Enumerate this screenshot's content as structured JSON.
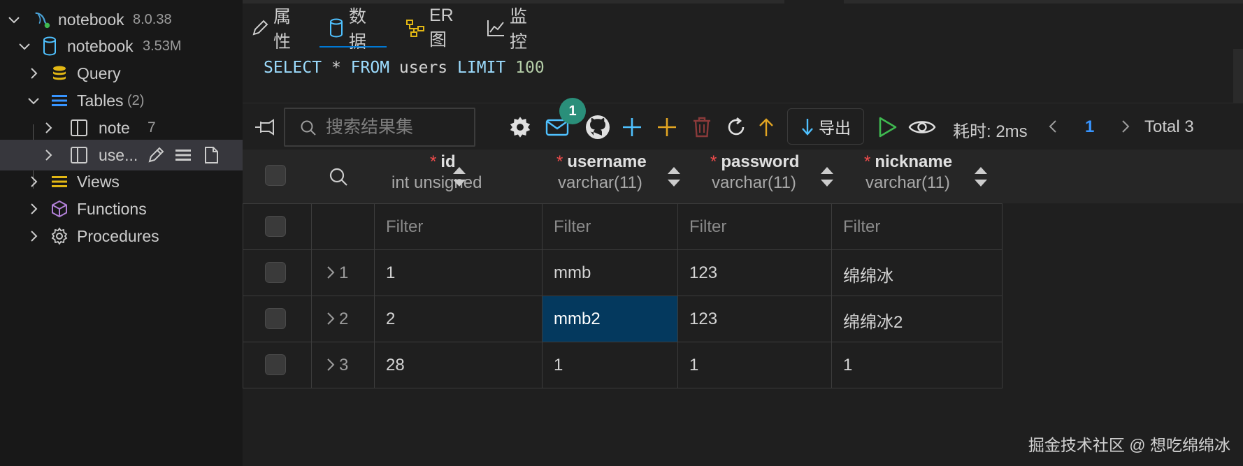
{
  "sidebar": {
    "connection": {
      "label": "notebook",
      "version": "8.0.38"
    },
    "database": {
      "label": "notebook",
      "size": "3.53M"
    },
    "query": {
      "label": "Query"
    },
    "tables": {
      "label": "Tables",
      "count": "(2)"
    },
    "table_note": {
      "label": "note",
      "count": "7"
    },
    "table_users": {
      "label": "use..."
    },
    "views": {
      "label": "Views"
    },
    "functions": {
      "label": "Functions"
    },
    "procedures": {
      "label": "Procedures"
    }
  },
  "tabs": [
    {
      "label": "属性",
      "icon": "pencil-icon"
    },
    {
      "label": "数据",
      "icon": "database-icon",
      "active": true
    },
    {
      "label": "ER图",
      "icon": "er-diagram-icon"
    },
    {
      "label": "监控",
      "icon": "chart-line-icon"
    }
  ],
  "sql": {
    "kw_select": "SELECT",
    "star": "*",
    "kw_from": "FROM",
    "table": "users",
    "kw_limit": "LIMIT",
    "limit": "100"
  },
  "toolbar": {
    "search_placeholder": "搜索结果集",
    "badge_count": "1",
    "export_label": "导出",
    "elapsed": "耗时: 2ms",
    "page": "1",
    "total": "Total 3",
    "colors": {
      "accent_blue": "#4fc1ff",
      "add_plus": "#e2a522",
      "delete_red": "#8b3a3a",
      "run_green": "#3fb950",
      "page_blue": "#3794ff"
    }
  },
  "columns": [
    {
      "name": "id",
      "type": "int unsigned",
      "required": "*"
    },
    {
      "name": "username",
      "type": "varchar(11)",
      "required": "*"
    },
    {
      "name": "password",
      "type": "varchar(11)",
      "required": "*"
    },
    {
      "name": "nickname",
      "type": "varchar(11)",
      "required": "*"
    }
  ],
  "filter_placeholder": "Filter",
  "rows": [
    {
      "num": "1",
      "id": "1",
      "username": "mmb",
      "password": "123",
      "nickname": "绵绵冰"
    },
    {
      "num": "2",
      "id": "2",
      "username": "mmb2",
      "password": "123",
      "nickname": "绵绵冰2"
    },
    {
      "num": "3",
      "id": "28",
      "username": "1",
      "password": "1",
      "nickname": "1"
    }
  ],
  "watermark": "掘金技术社区 @ 想吃绵绵冰"
}
